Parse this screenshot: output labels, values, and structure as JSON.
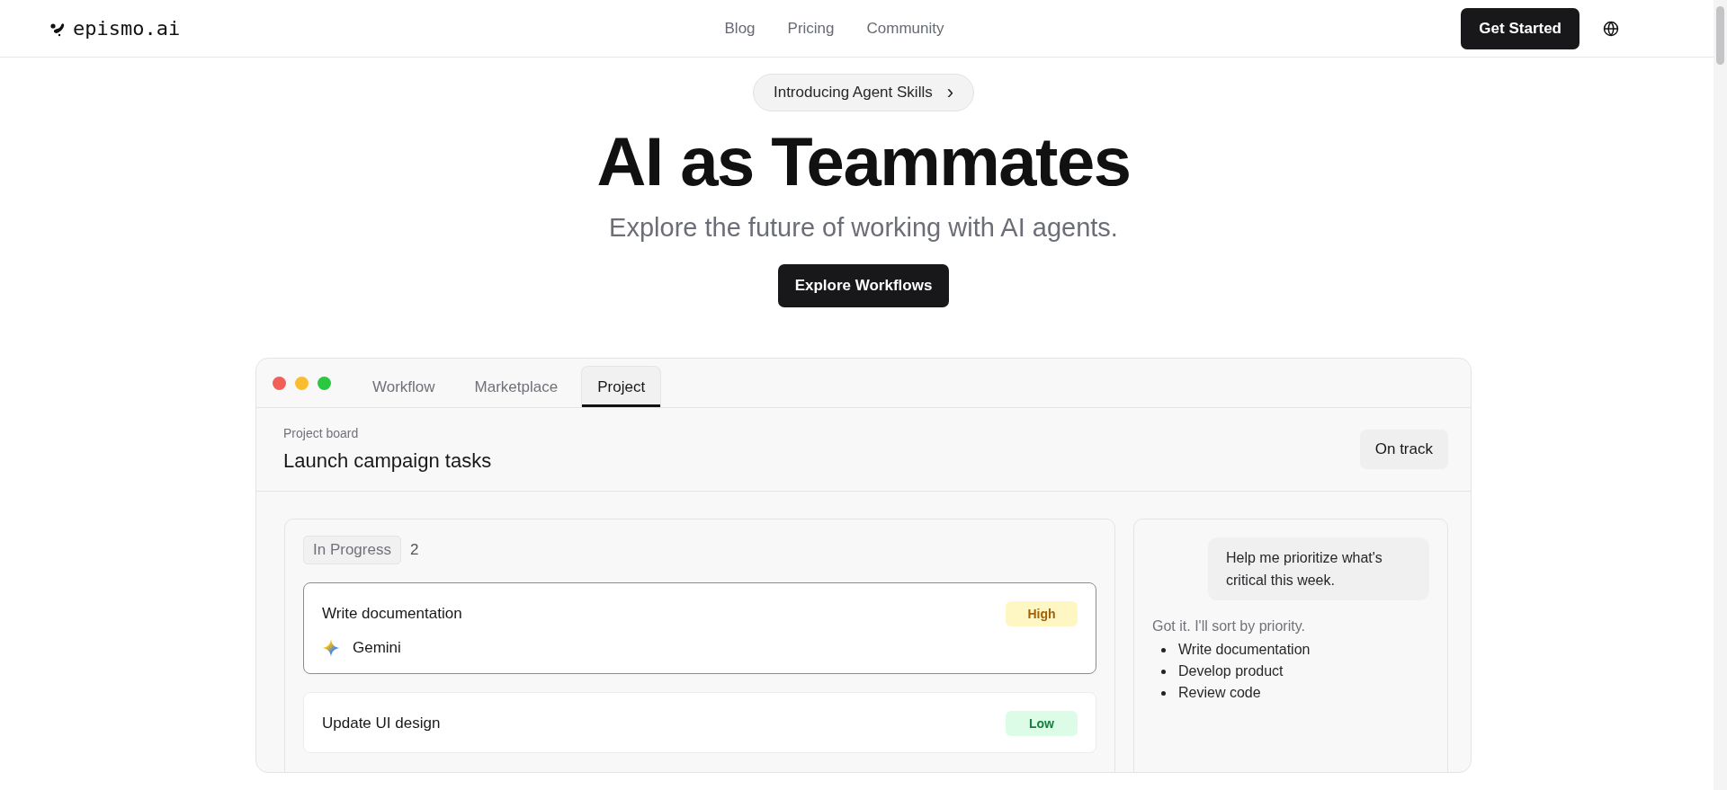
{
  "brand": {
    "name": "epismo.ai"
  },
  "nav": [
    {
      "label": "Blog"
    },
    {
      "label": "Pricing"
    },
    {
      "label": "Community"
    }
  ],
  "header_cta": "Get Started",
  "announcement": {
    "label": "Introducing Agent Skills",
    "arrow": "›"
  },
  "hero": {
    "title": "AI as Teammates",
    "subtitle": "Explore the future of working with AI agents.",
    "cta": "Explore Workflows"
  },
  "demo": {
    "tabs": [
      {
        "label": "Workflow",
        "selected": false
      },
      {
        "label": "Marketplace",
        "selected": false
      },
      {
        "label": "Project",
        "selected": true
      }
    ],
    "board": {
      "eyebrow": "Project board",
      "title": "Launch campaign tasks",
      "status": "On track"
    },
    "column": {
      "title": "In Progress",
      "count": "2",
      "cards": [
        {
          "title": "Write documentation",
          "priority": "High",
          "kind": "high",
          "assignee": "Gemini",
          "selected": true
        },
        {
          "title": "Update UI design",
          "priority": "Low",
          "kind": "low",
          "selected": false
        }
      ]
    },
    "chat": {
      "user_message": "Help me prioritize what's critical this week.",
      "reply": "Got it. I'll sort by priority.",
      "items": [
        "Write documentation",
        "Develop product",
        "Review code"
      ]
    }
  }
}
